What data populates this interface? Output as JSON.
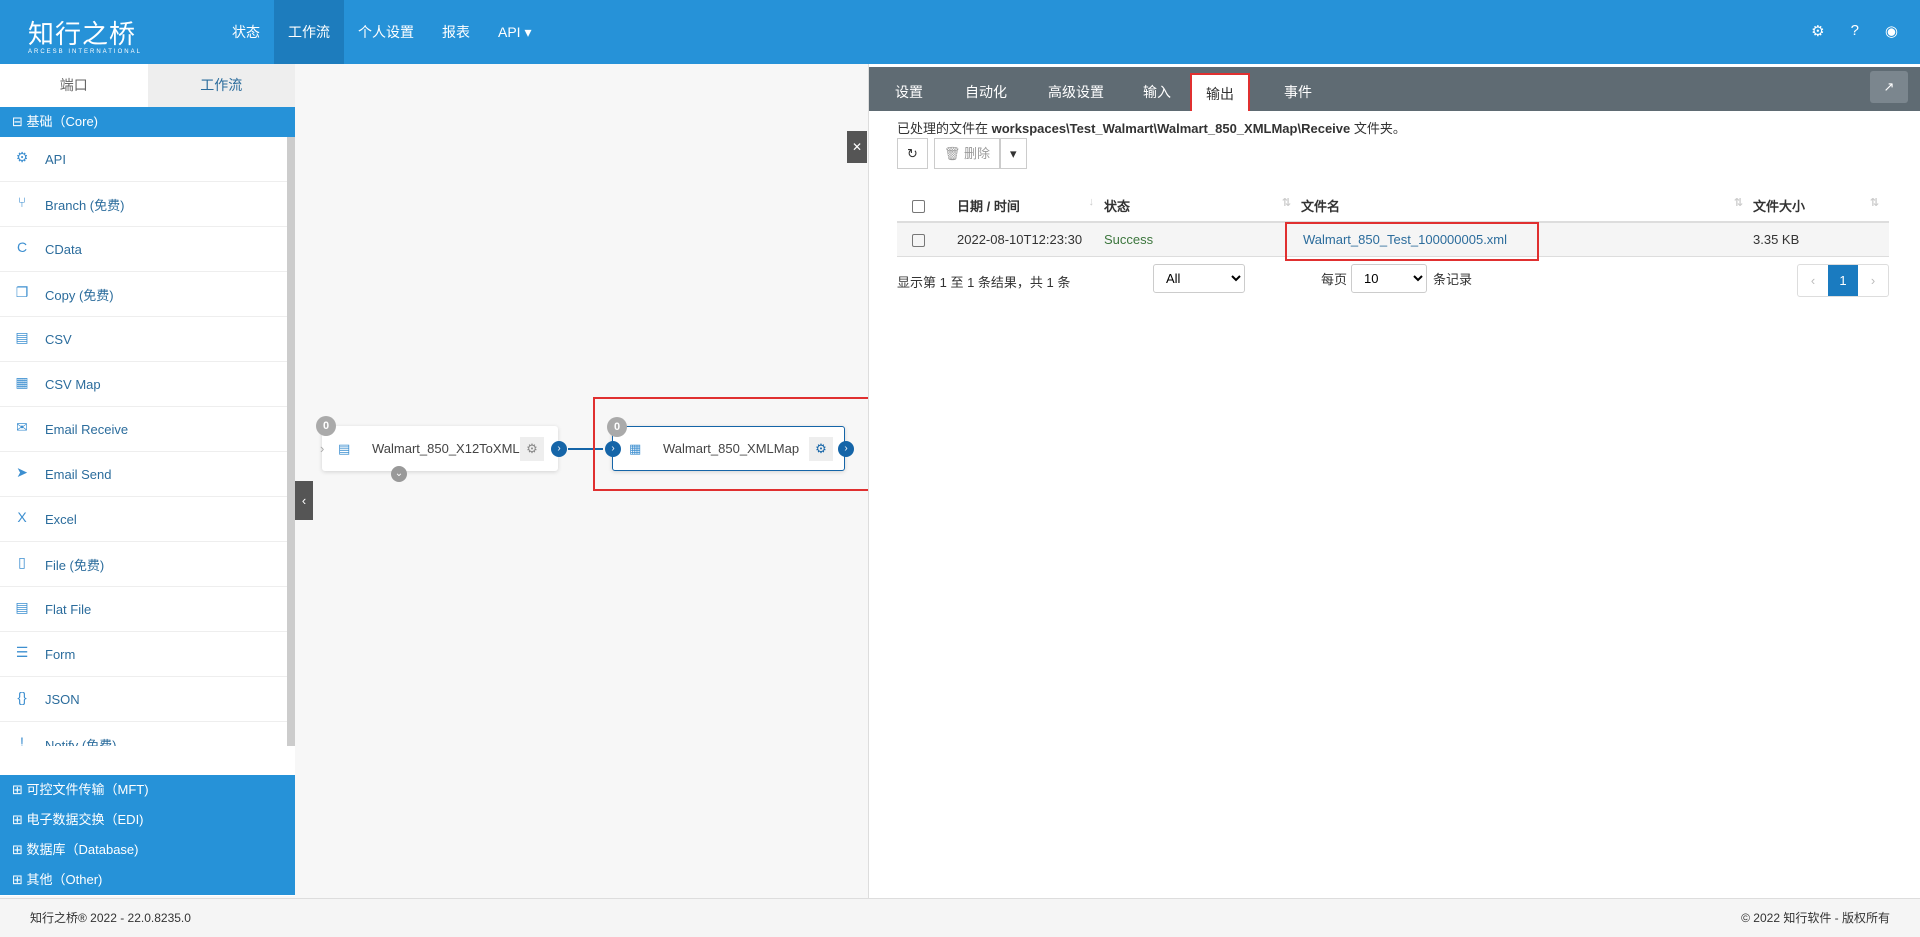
{
  "header": {
    "logo": "知行之桥",
    "logo_sub": "ARCESB INTERNATIONAL",
    "nav": [
      "状态",
      "工作流",
      "个人设置",
      "报表",
      "API ▾"
    ]
  },
  "sidebar": {
    "tabs": [
      "端口",
      "工作流"
    ],
    "core": "⊟ 基础（Core)",
    "items": [
      {
        "label": "API",
        "icon": "⚙"
      },
      {
        "label": "Branch (免费)",
        "icon": "⑂"
      },
      {
        "label": "CData",
        "icon": "C"
      },
      {
        "label": "Copy (免费)",
        "icon": "❐"
      },
      {
        "label": "CSV",
        "icon": "▤"
      },
      {
        "label": "CSV Map",
        "icon": "▦"
      },
      {
        "label": "Email Receive",
        "icon": "✉"
      },
      {
        "label": "Email Send",
        "icon": "➤"
      },
      {
        "label": "Excel",
        "icon": "X"
      },
      {
        "label": "File (免费)",
        "icon": "▯"
      },
      {
        "label": "Flat File",
        "icon": "▤"
      },
      {
        "label": "Form",
        "icon": "☰"
      },
      {
        "label": "JSON",
        "icon": "{}"
      },
      {
        "label": "Notify (免费)",
        "icon": "!"
      }
    ],
    "categories": [
      "⊞ 可控文件传输（MFT)",
      "⊞ 电子数据交换（EDI)",
      "⊞ 数据库（Database)",
      "⊞ 其他（Other)"
    ]
  },
  "canvas": {
    "node1": {
      "name": "Walmart_850_X12ToXML",
      "count": "0"
    },
    "node2": {
      "name": "Walmart_850_XMLMap",
      "count": "0"
    }
  },
  "panel": {
    "tabs": [
      "设置",
      "自动化",
      "高级设置",
      "输入",
      "输出",
      "事件"
    ],
    "info_prefix": "已处理的文件在 ",
    "info_path": "workspaces\\Test_Walmart\\Walmart_850_XMLMap\\Receive",
    "info_suffix": " 文件夹。",
    "delete_label": "🗑 删除",
    "columns": [
      "日期 / 时间",
      "状态",
      "文件名",
      "文件大小"
    ],
    "rows": [
      {
        "date": "2022-08-10T12:23:30",
        "status": "Success",
        "file": "Walmart_850_Test_100000005.xml",
        "size": "3.35 KB"
      }
    ],
    "summary": "显示第 1 至 1 条结果，共 1 条",
    "filter": "All",
    "per_page_label": "每页",
    "per_page": "10",
    "records_label": "条记录",
    "page": "1"
  },
  "footer": {
    "left": "知行之桥® 2022 - 22.0.8235.0",
    "right": "© 2022 知行软件 - 版权所有"
  }
}
